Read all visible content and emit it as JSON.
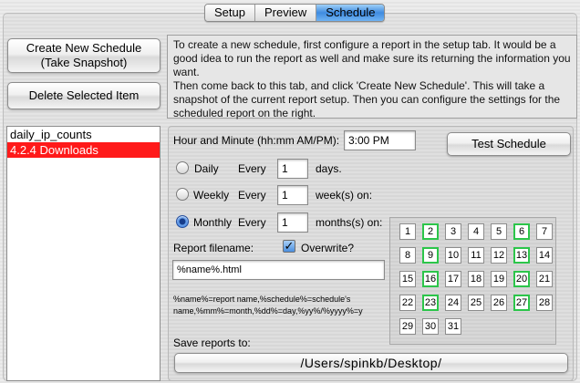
{
  "tabs": [
    {
      "label": "Setup",
      "active": false
    },
    {
      "label": "Preview",
      "active": false
    },
    {
      "label": "Schedule",
      "active": true
    }
  ],
  "buttons": {
    "create_line1": "Create New Schedule",
    "create_line2": "(Take Snapshot)",
    "delete": "Delete Selected Item",
    "test": "Test Schedule"
  },
  "help_text": "To create a new schedule, first configure a report in the setup tab. It would be a good idea to run the report as well and make sure its returning the information you want.\nThen come back to this tab, and click 'Create New Schedule'. This will take a snapshot of the current report setup. Then you can configure the settings for the scheduled report on the right.",
  "schedule_list": [
    {
      "label": "daily_ip_counts",
      "selected": false
    },
    {
      "label": "4.2.4 Downloads",
      "selected": true
    }
  ],
  "time": {
    "label": "Hour and Minute (hh:mm AM/PM):",
    "value": "3:00 PM"
  },
  "recurrence": {
    "daily": {
      "label": "Daily",
      "every": "Every",
      "value": "1",
      "unit": "days.",
      "selected": false
    },
    "weekly": {
      "label": "Weekly",
      "every": "Every",
      "value": "1",
      "unit": "week(s) on:",
      "selected": false
    },
    "monthly": {
      "label": "Monthly",
      "every": "Every",
      "value": "1",
      "unit": "months(s) on:",
      "selected": true
    }
  },
  "report_filename": {
    "label": "Report filename:",
    "value": "%name%.html"
  },
  "overwrite": {
    "label": "Overwrite?",
    "checked": true
  },
  "variables_hint_line1": "%name%=report name,%schedule%=schedule's",
  "variables_hint_line2": "name,%mm%=month,%dd%=day,%yy%/%yyyy%=y",
  "days": [
    "1",
    "2",
    "3",
    "4",
    "5",
    "6",
    "7",
    "8",
    "9",
    "10",
    "11",
    "12",
    "13",
    "14",
    "15",
    "16",
    "17",
    "18",
    "19",
    "20",
    "21",
    "22",
    "23",
    "24",
    "25",
    "26",
    "27",
    "28",
    "29",
    "30",
    "31"
  ],
  "selected_days": [
    "2",
    "6",
    "9",
    "13",
    "16",
    "20",
    "23",
    "27"
  ],
  "save": {
    "label": "Save reports to:",
    "path": "/Users/spinkb/Desktop/"
  },
  "colors": {
    "selected_row": "#ff1a1a",
    "selected_day_border": "#2cc54a",
    "active_tab": "#3f8be0"
  }
}
